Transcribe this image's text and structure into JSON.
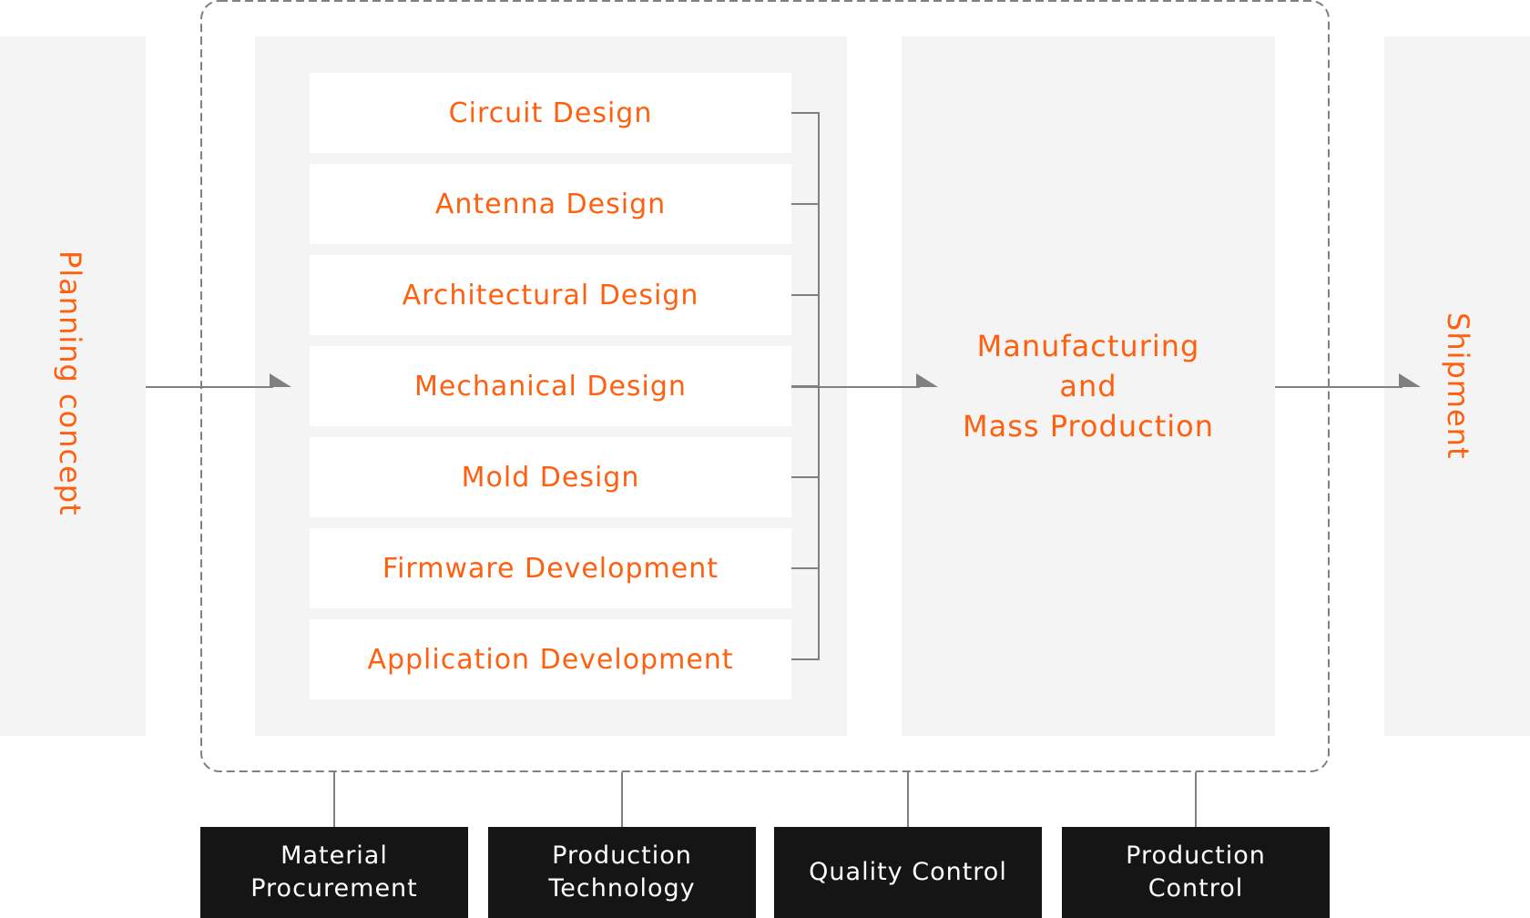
{
  "colors": {
    "accent": "#ff6010",
    "panel": "#f4f4f4",
    "line": "#808080",
    "dark_box": "#151515"
  },
  "planning": {
    "label": "Planning concept"
  },
  "design_steps": [
    "Circuit Design",
    "Antenna Design",
    "Architectural Design",
    "Mechanical Design",
    "Mold Design",
    "Firmware Development",
    "Application Development"
  ],
  "manufacturing": {
    "line1": "Manufacturing",
    "line2": "and",
    "line3": "Mass Production"
  },
  "shipment": {
    "label": "Shipment"
  },
  "support_functions": [
    {
      "line1": "Material",
      "line2": "Procurement"
    },
    {
      "line1": "Production",
      "line2": "Technology"
    },
    {
      "line1": "Quality Control",
      "line2": ""
    },
    {
      "line1": "Production",
      "line2": "Control"
    }
  ]
}
